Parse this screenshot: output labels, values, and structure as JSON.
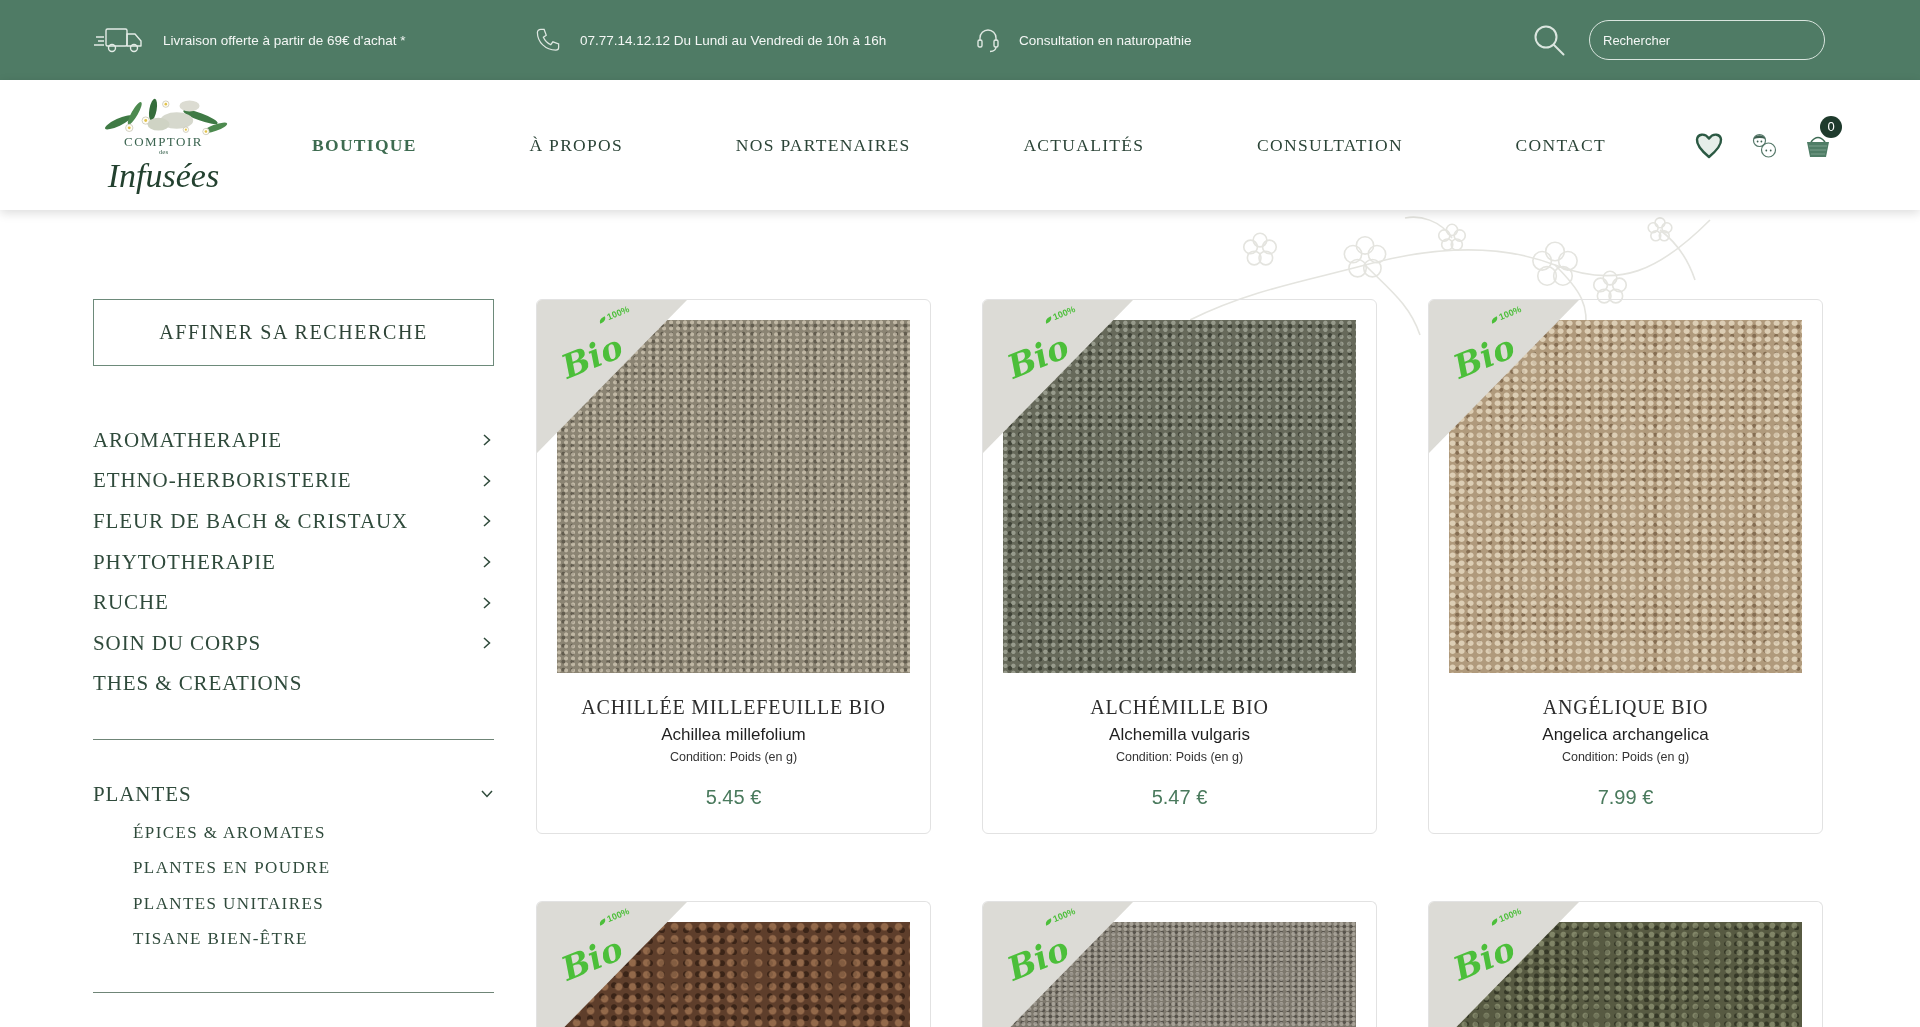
{
  "top_bar": {
    "items": [
      {
        "kind": "delivery",
        "text": "Livraison offerte à partir de 69€ d'achat *"
      },
      {
        "kind": "phone",
        "text": "07.77.14.12.12 Du Lundi au Vendredi de 10h à 16h"
      },
      {
        "kind": "consultation",
        "text": "Consultation en naturopathie"
      }
    ],
    "search": {
      "placeholder": "Rechercher"
    }
  },
  "header": {
    "logo": {
      "upper": "COMPTOIR",
      "small": "des",
      "script": "Infusées"
    },
    "nav": [
      {
        "label": "BOUTIQUE",
        "selected": true
      },
      {
        "label": "À PROPOS",
        "selected": false
      },
      {
        "label": "NOS PARTENAIRES",
        "selected": false
      },
      {
        "label": "ACTUALITÉS",
        "selected": false
      },
      {
        "label": "CONSULTATION",
        "selected": false
      },
      {
        "label": "CONTACT",
        "selected": false
      }
    ],
    "cart": {
      "count": "0"
    }
  },
  "sidebar": {
    "filter_button": "AFFINER SA RECHERCHE",
    "groups": [
      {
        "items": [
          {
            "kind": "submenu",
            "label": "AROMATHERAPIE",
            "expanded": false
          },
          {
            "kind": "submenu",
            "label": "ETHNO-HERBORISTERIE",
            "expanded": false
          },
          {
            "kind": "submenu",
            "label": "FLEUR DE BACH & CRISTAUX",
            "expanded": false
          },
          {
            "kind": "submenu",
            "label": "PHYTOTHERAPIE",
            "expanded": false
          },
          {
            "kind": "submenu",
            "label": "RUCHE",
            "expanded": false
          },
          {
            "kind": "submenu",
            "label": "SOIN DU CORPS",
            "expanded": false
          },
          {
            "kind": "link",
            "label": "THES & CREATIONS"
          }
        ]
      },
      {
        "items": [
          {
            "kind": "submenu",
            "label": "PLANTES",
            "expanded": true,
            "children": [
              {
                "label": "ÉPICES & AROMATES"
              },
              {
                "label": "PLANTES EN POUDRE"
              },
              {
                "label": "PLANTES UNITAIRES"
              },
              {
                "label": "TISANE BIEN-ÊTRE"
              }
            ]
          }
        ]
      }
    ]
  },
  "products": [
    {
      "badge": {
        "text": "Bio",
        "percent": "100%"
      },
      "name": "ACHILLÉE MILLEFEUILLE BIO",
      "latin_name": "Achillea millefolium",
      "condition": "Condition: Poids (en g)",
      "price": "5.45 €"
    },
    {
      "badge": {
        "text": "Bio",
        "percent": "100%"
      },
      "name": "ALCHÉMILLE BIO",
      "latin_name": "Alchemilla vulgaris",
      "condition": "Condition: Poids (en g)",
      "price": "5.47 €"
    },
    {
      "badge": {
        "text": "Bio",
        "percent": "100%"
      },
      "name": "ANGÉLIQUE BIO",
      "latin_name": "Angelica archangelica",
      "condition": "Condition: Poids (en g)",
      "price": "7.99 €"
    },
    {
      "badge": {
        "text": "Bio",
        "percent": "100%"
      }
    },
    {
      "badge": {
        "text": "Bio",
        "percent": "100%"
      }
    },
    {
      "badge": {
        "text": "Bio",
        "percent": "100%"
      }
    }
  ]
}
